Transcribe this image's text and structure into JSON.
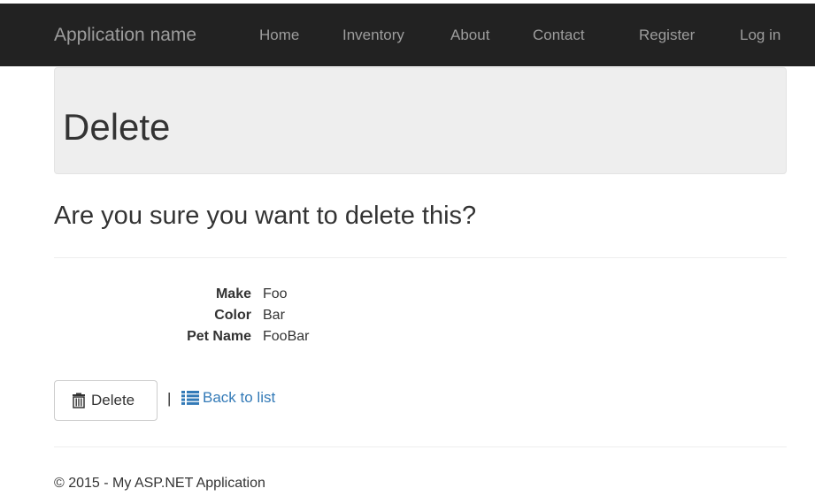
{
  "navbar": {
    "brand": "Application name",
    "links": [
      "Home",
      "Inventory",
      "About",
      "Contact"
    ],
    "right_links": [
      "Register",
      "Log in"
    ]
  },
  "jumbotron": {
    "title": "Delete"
  },
  "question": "Are you sure you want to delete this?",
  "details": [
    {
      "label": "Make",
      "value": "Foo"
    },
    {
      "label": "Color",
      "value": "Bar"
    },
    {
      "label": "Pet Name",
      "value": "FooBar"
    }
  ],
  "actions": {
    "delete_label": "Delete",
    "separator": "|",
    "back_label": "Back to list",
    "delete_icon": "trash-icon",
    "back_icon": "list-icon"
  },
  "footer": {
    "text": "© 2015 - My ASP.NET Application"
  },
  "colors": {
    "navbar_bg": "#222222",
    "nav_text": "#9d9d9d",
    "jumbotron_bg": "#eeeeee",
    "link": "#337ab7"
  }
}
